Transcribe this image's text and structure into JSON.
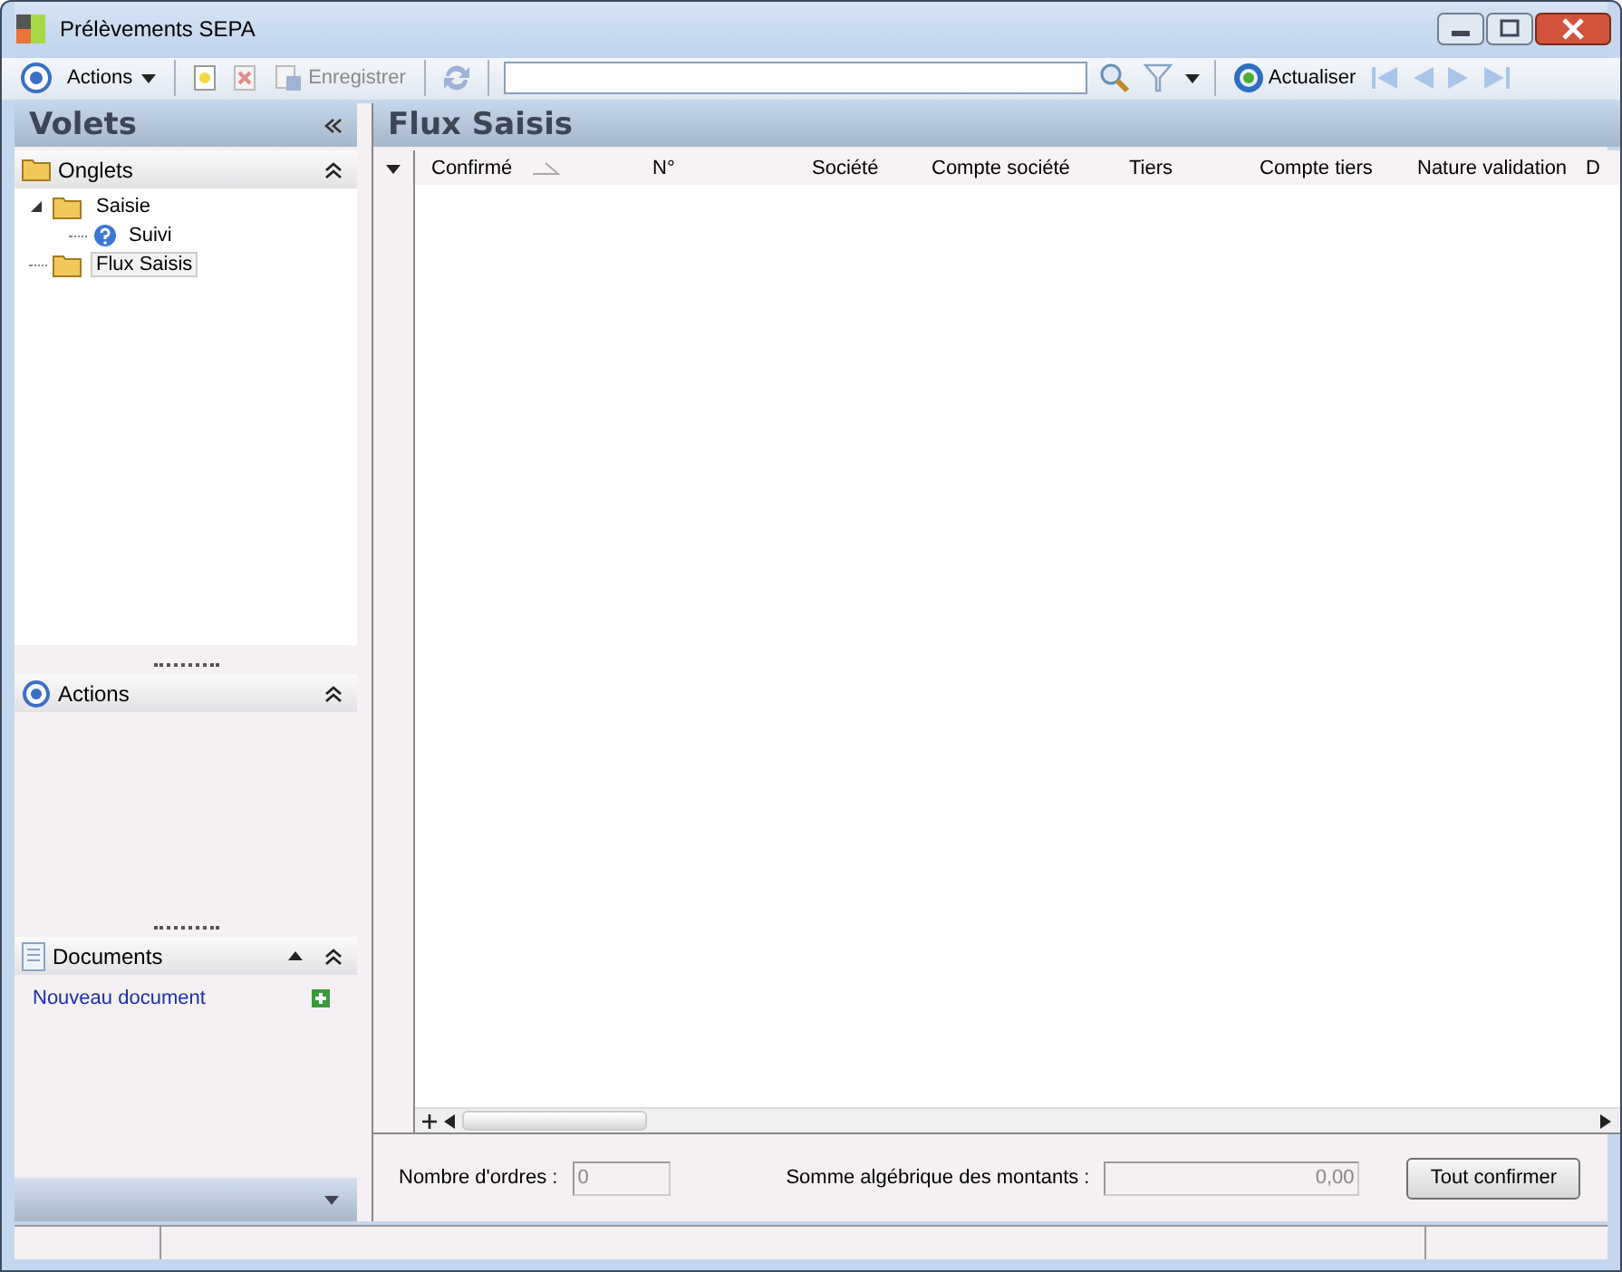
{
  "window": {
    "title": "Prélèvements SEPA"
  },
  "toolbar": {
    "actions_menu": "Actions",
    "save": "Enregistrer",
    "refresh": "Actualiser"
  },
  "sidebar": {
    "title": "Volets",
    "onglets": {
      "title": "Onglets",
      "tree": [
        {
          "label": "Saisie",
          "expanded": true,
          "selected": false,
          "children": [
            {
              "label": "Suivi",
              "selected": false
            }
          ]
        },
        {
          "label": "Flux Saisis",
          "selected": true
        }
      ]
    },
    "actions": {
      "title": "Actions"
    },
    "documents": {
      "title": "Documents",
      "link": "Nouveau document"
    }
  },
  "main": {
    "title": "Flux Saisis",
    "columns": [
      {
        "label": "Confirmé",
        "sorted": true
      },
      {
        "label": "N°",
        "sorted": false
      },
      {
        "label": "Société",
        "sorted": false
      },
      {
        "label": "Compte société",
        "sorted": false
      },
      {
        "label": "Tiers",
        "sorted": false
      },
      {
        "label": "Compte tiers",
        "sorted": false
      },
      {
        "label": "Nature validation",
        "sorted": false
      },
      {
        "label": "D",
        "sorted": false
      }
    ]
  },
  "footer": {
    "count_label": "Nombre d'ordres :",
    "count": "0",
    "sum_label": "Somme algébrique des montants :",
    "sum": "0,00",
    "confirm_button": "Tout confirmer"
  }
}
